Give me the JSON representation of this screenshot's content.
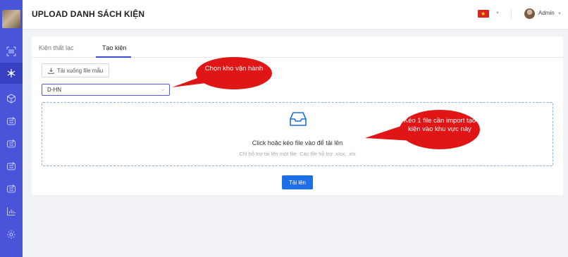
{
  "header": {
    "title": "UPLOAD DANH SÁCH KIỆN",
    "user": "Admin"
  },
  "sidebar": {
    "items": [
      {
        "icon": "barcode-scan-icon"
      },
      {
        "icon": "asterisk-icon",
        "active": true
      },
      {
        "icon": "box-icon"
      },
      {
        "icon": "transfer-icon"
      },
      {
        "icon": "transfer-icon"
      },
      {
        "icon": "transfer-icon"
      },
      {
        "icon": "transfer-icon"
      },
      {
        "icon": "bar-chart-icon"
      },
      {
        "icon": "settings-sun-icon"
      }
    ]
  },
  "tabs": [
    {
      "label": "Kiện thất lạc",
      "active": false
    },
    {
      "label": "Tạo kiện",
      "active": true
    }
  ],
  "toolbar": {
    "download_label": "Tải xuống file mẫu"
  },
  "warehouse_select": {
    "value": "D-HN"
  },
  "dropzone": {
    "title": "Click hoặc kéo file vào để tải lên",
    "hint": "Chỉ hỗ trợ tải lên một file. Các file hỗ trợ .xlsx, .xls"
  },
  "upload_button": {
    "label": "Tải lên"
  },
  "callouts": [
    {
      "text": "Chọn kho vận hành"
    },
    {
      "text": "Kéo 1 file cần import tạo kiện vào khu vực này"
    }
  ],
  "colors": {
    "sidebar": "#4a54d8",
    "primary": "#1c6fe8",
    "callout": "#e01515"
  }
}
